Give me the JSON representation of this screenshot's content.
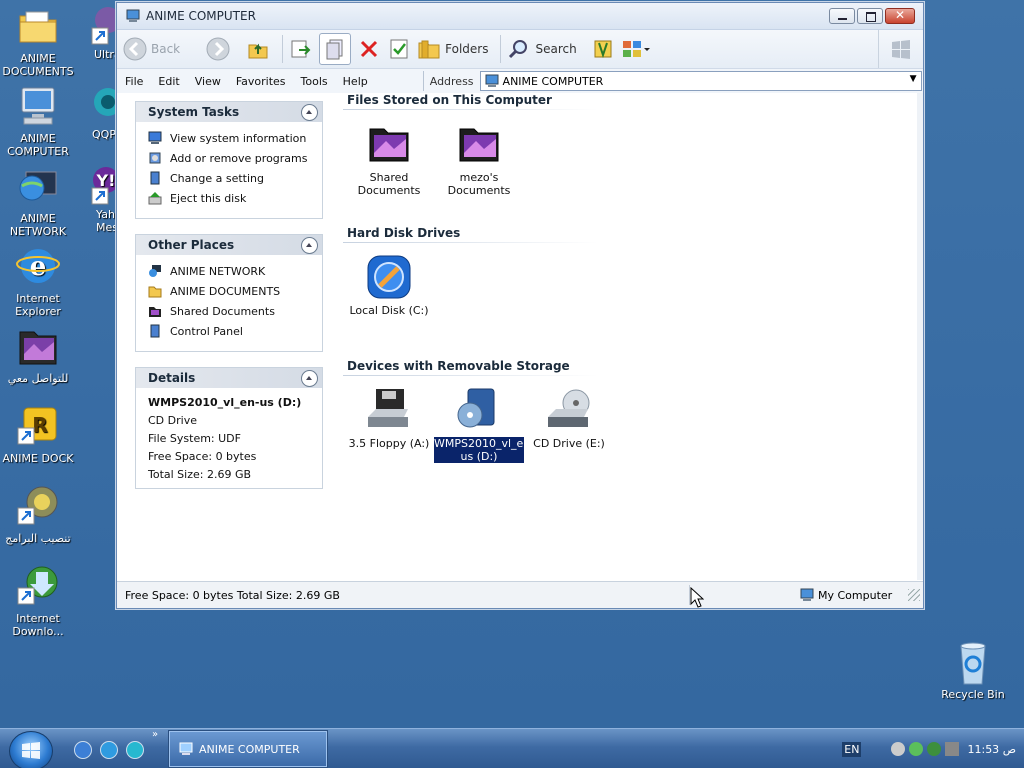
{
  "desktop": {
    "icons_left": [
      {
        "label": "ANIME DOCUMENTS",
        "icon": "folder-documents-icon"
      },
      {
        "label": "ANIME COMPUTER",
        "icon": "computer-icon"
      },
      {
        "label": "ANIME NETWORK",
        "icon": "network-globe-icon"
      },
      {
        "label": "Internet Explorer",
        "icon": "internet-explorer-icon"
      },
      {
        "label": "للتواصل معي",
        "icon": "purple-folder-icon"
      },
      {
        "label": "ANIME DOCK",
        "icon": "dock-shortcut-icon"
      },
      {
        "label": "تنصيب البرامج",
        "icon": "setup-shortcut-icon"
      },
      {
        "label": "Internet Downlo...",
        "icon": "download-manager-icon"
      }
    ],
    "icons_partial": [
      {
        "label": "Ultra",
        "icon": "ultra-shortcut-icon"
      },
      {
        "label": "QQP",
        "icon": "qqp-shortcut-icon"
      },
      {
        "label": "Yah Messe",
        "icon": "yahoo-messenger-icon"
      }
    ],
    "recycle_bin": "Recycle Bin"
  },
  "window": {
    "title": "ANIME COMPUTER",
    "toolbar": {
      "back": "Back",
      "folders": "Folders",
      "search": "Search"
    },
    "menu": [
      "File",
      "Edit",
      "View",
      "Favorites",
      "Tools",
      "Help"
    ],
    "address_label": "Address",
    "address_value": "ANIME COMPUTER",
    "panels": {
      "system_tasks": {
        "title": "System Tasks",
        "items": [
          "View system information",
          "Add or remove programs",
          "Change a setting",
          "Eject this disk"
        ]
      },
      "other_places": {
        "title": "Other Places",
        "items": [
          "ANIME NETWORK",
          "ANIME DOCUMENTS",
          "Shared Documents",
          "Control Panel"
        ]
      },
      "details": {
        "title": "Details",
        "name": "WMPS2010_vl_en-us (D:)",
        "type": "CD Drive",
        "filesystem": "File System: UDF",
        "free": "Free Space: 0 bytes",
        "total": "Total Size: 2.69 GB"
      }
    },
    "sections": {
      "files_stored": {
        "title": "Files Stored on This Computer",
        "items": [
          {
            "label": "Shared Documents"
          },
          {
            "label": "mezo's Documents"
          }
        ]
      },
      "hard_disks": {
        "title": "Hard Disk Drives",
        "items": [
          {
            "label": "Local Disk (C:)"
          }
        ]
      },
      "removable": {
        "title": "Devices with Removable Storage",
        "items": [
          {
            "label": "3.5 Floppy (A:)"
          },
          {
            "label": "WMPS2010_vl_en-us (D:)"
          },
          {
            "label": "CD Drive (E:)"
          }
        ]
      }
    },
    "status": {
      "left": "Free Space: 0 bytes Total Size: 2.69 GB",
      "right": "My Computer"
    }
  },
  "taskbar": {
    "active_window": "ANIME COMPUTER",
    "language": "EN",
    "clock": "11:53 ص"
  },
  "colors": {
    "desktop": "#3a6ea5",
    "selection": "#0a246a",
    "taskbar": "#3e6aa3"
  }
}
